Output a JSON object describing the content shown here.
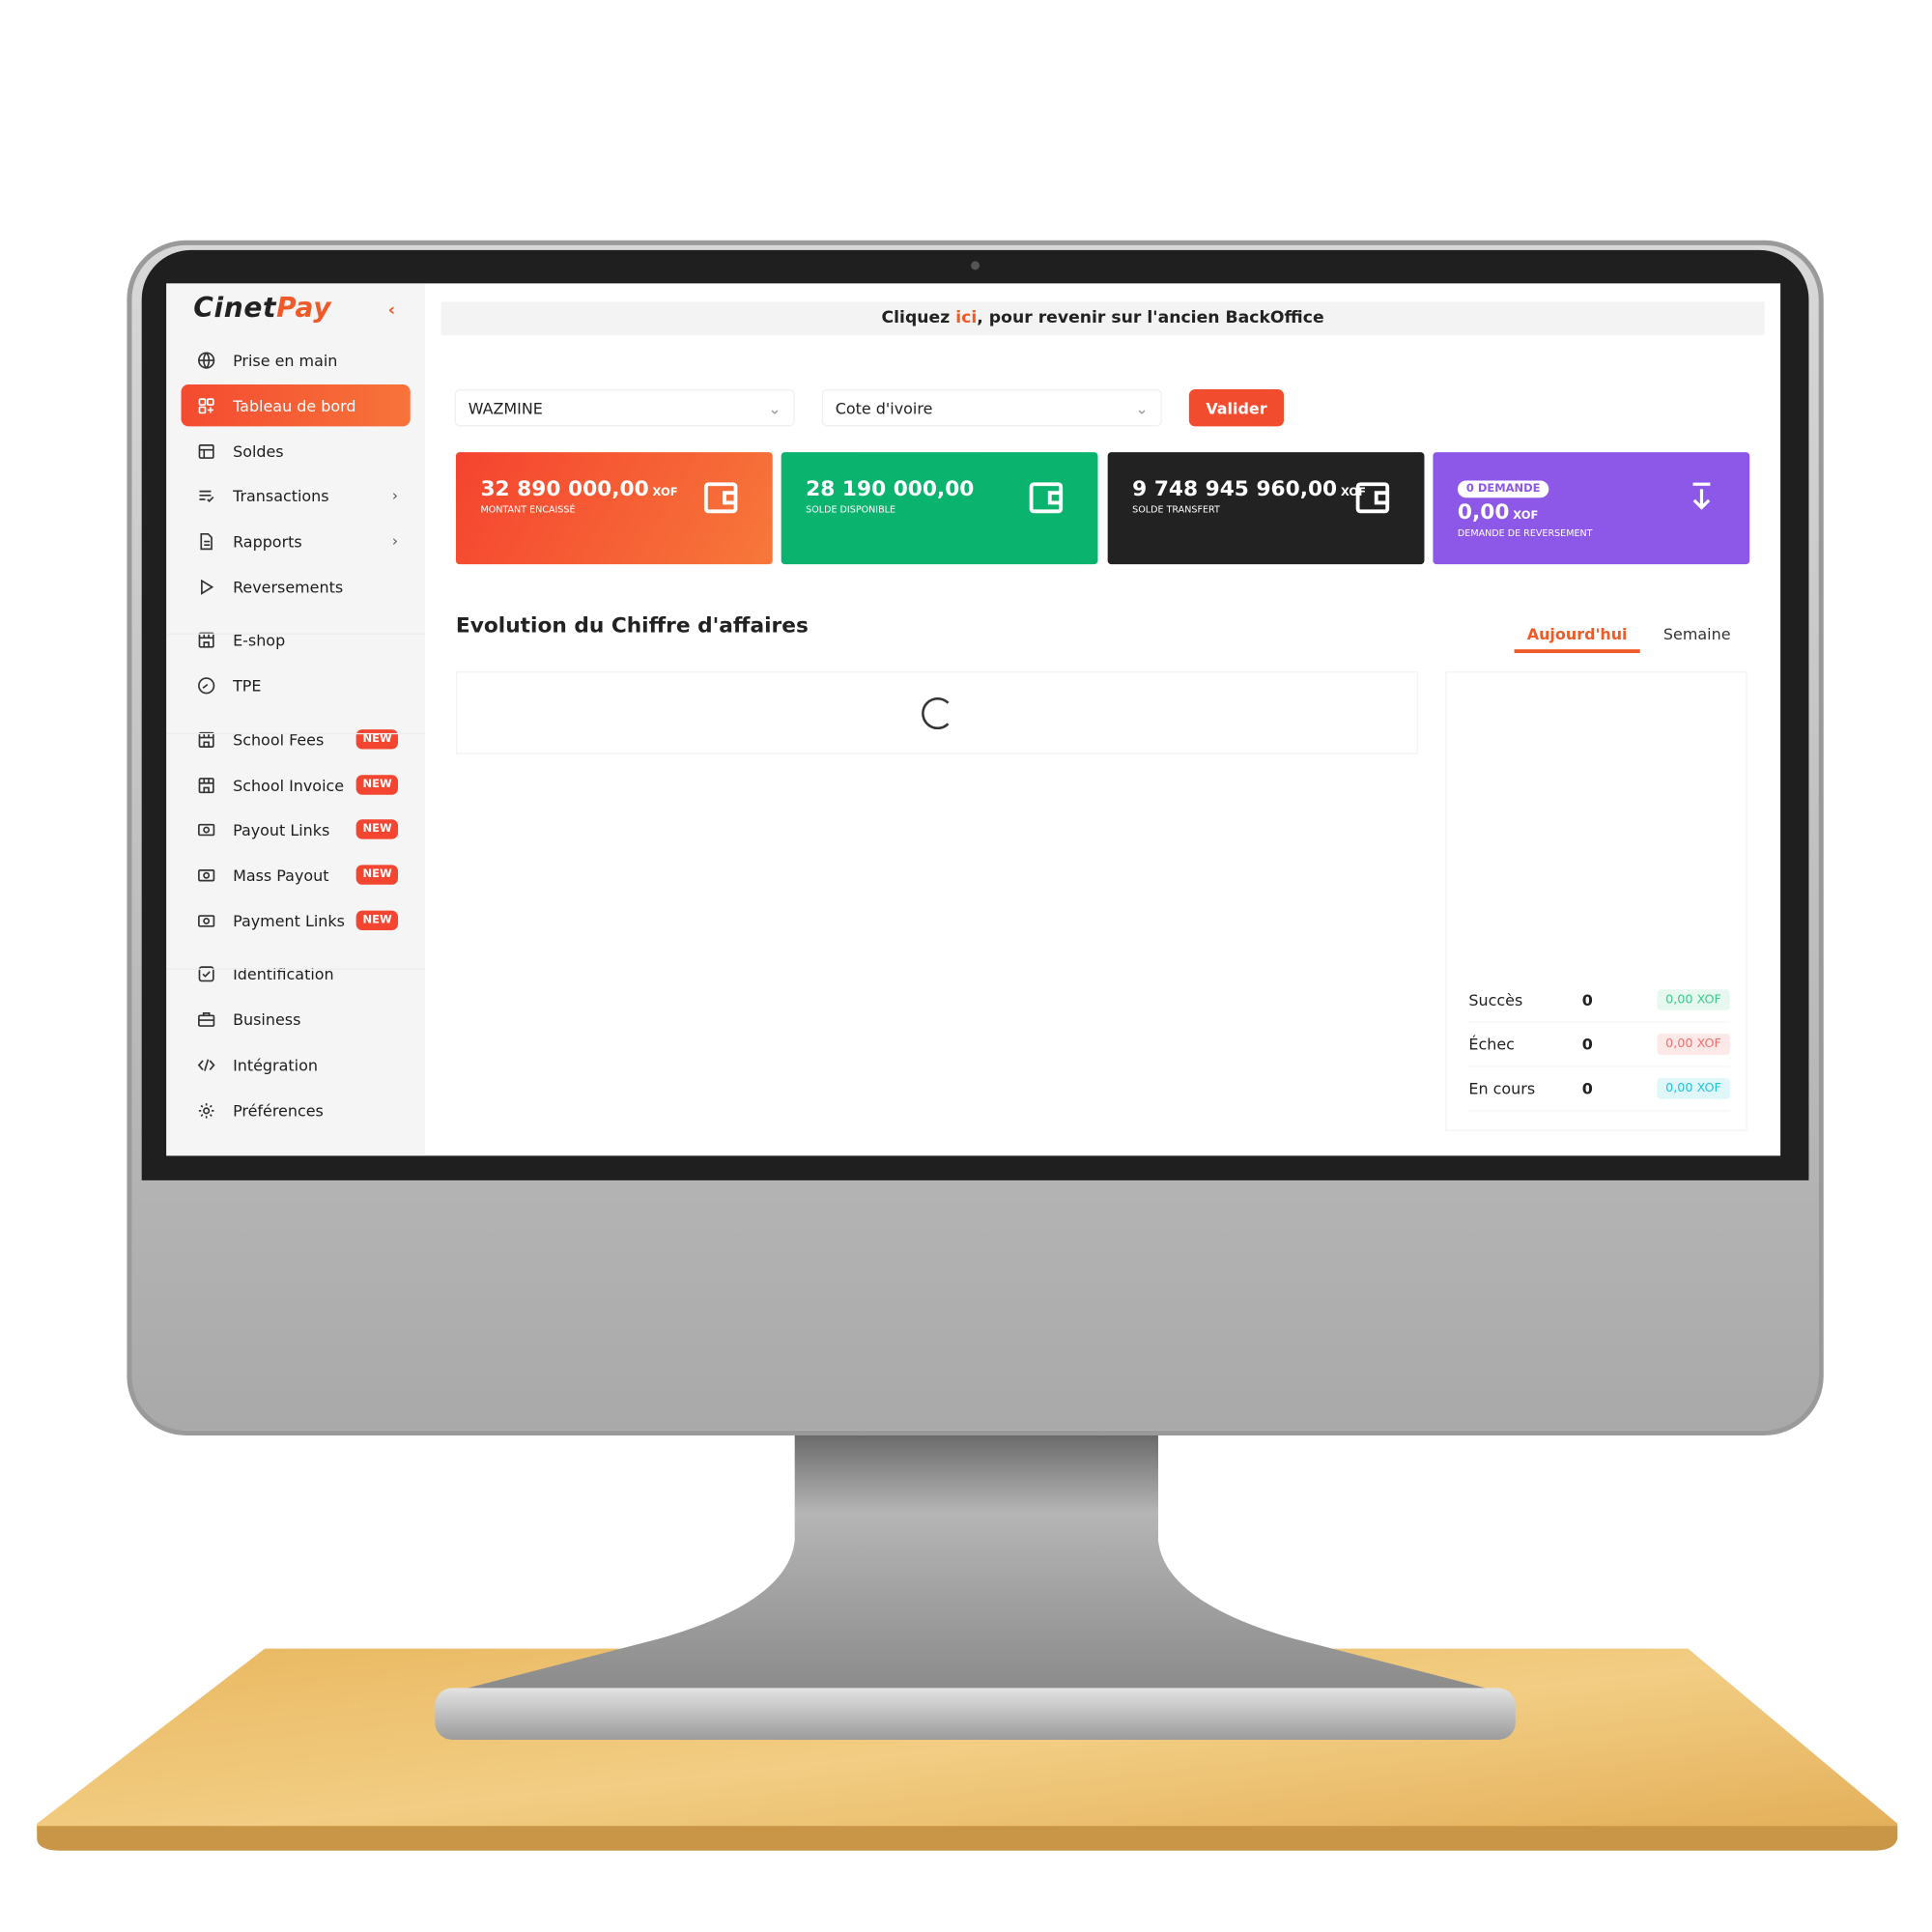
{
  "logo": {
    "text_a": "Cinet",
    "text_b": "Pay"
  },
  "banner": {
    "before": "Cliquez ",
    "link": "ici",
    "after": ", pour revenir sur l'ancien BackOffice"
  },
  "sidebar": {
    "items": [
      {
        "label": "Prise en main",
        "icon": "globe-icon"
      },
      {
        "label": "Tableau de bord",
        "icon": "dashboard-icon",
        "active": true
      },
      {
        "label": "Soldes",
        "icon": "wallet-icon"
      },
      {
        "label": "Transactions",
        "icon": "list-check-icon",
        "chevron": true
      },
      {
        "label": "Rapports",
        "icon": "document-icon",
        "chevron": true
      },
      {
        "label": "Reversements",
        "icon": "play-icon"
      },
      {
        "label": "E-shop",
        "icon": "store-icon"
      },
      {
        "label": "TPE",
        "icon": "gauge-icon"
      },
      {
        "label": "School Fees",
        "icon": "store-icon",
        "badge": "NEW"
      },
      {
        "label": "School Invoice",
        "icon": "store-icon",
        "badge": "NEW"
      },
      {
        "label": "Payout Links",
        "icon": "money-icon",
        "badge": "NEW"
      },
      {
        "label": "Mass Payout",
        "icon": "money-icon",
        "badge": "NEW"
      },
      {
        "label": "Payment Links",
        "icon": "money-icon",
        "badge": "NEW"
      },
      {
        "label": "Identification",
        "icon": "check-square-icon"
      },
      {
        "label": "Business",
        "icon": "briefcase-icon"
      },
      {
        "label": "Intégration",
        "icon": "code-icon"
      },
      {
        "label": "Préférences",
        "icon": "gear-icon"
      }
    ]
  },
  "filters": {
    "merchant": "WAZMINE",
    "country": "Cote d'ivoire",
    "submit": "Valider"
  },
  "cards": [
    {
      "amount": "32 890 000,00",
      "currency": "XOF",
      "label": "MONTANT ENCAISSÉ",
      "color": "#f5552f"
    },
    {
      "amount": "28 190 000,00",
      "currency": "",
      "label": "SOLDE DISPONIBLE",
      "color": "#0ab46e"
    },
    {
      "amount": "9 748 945 960,00",
      "currency": "XOF",
      "label": "SOLDE TRANSFERT",
      "color": "#222222"
    },
    {
      "pill": "0 DEMANDE",
      "amount": "0,00",
      "currency": "XOF",
      "label": "DEMANDE DE REVERSEMENT",
      "color": "#8d58e8"
    }
  ],
  "chart": {
    "title": "Evolution du Chiffre d'affaires",
    "tabs": [
      "Aujourd'hui",
      "Semaine"
    ],
    "active_tab": "Aujourd'hui",
    "loading": true
  },
  "summary": [
    {
      "label": "Succès",
      "count": "0",
      "amount": "0,00 XOF",
      "fg": "#3cc98a",
      "bg": "#e6f8ef"
    },
    {
      "label": "Échec",
      "count": "0",
      "amount": "0,00 XOF",
      "fg": "#f07070",
      "bg": "#fde8e8"
    },
    {
      "label": "En cours",
      "count": "0",
      "amount": "0,00 XOF",
      "fg": "#22c3d6",
      "bg": "#e0f7fa"
    }
  ]
}
